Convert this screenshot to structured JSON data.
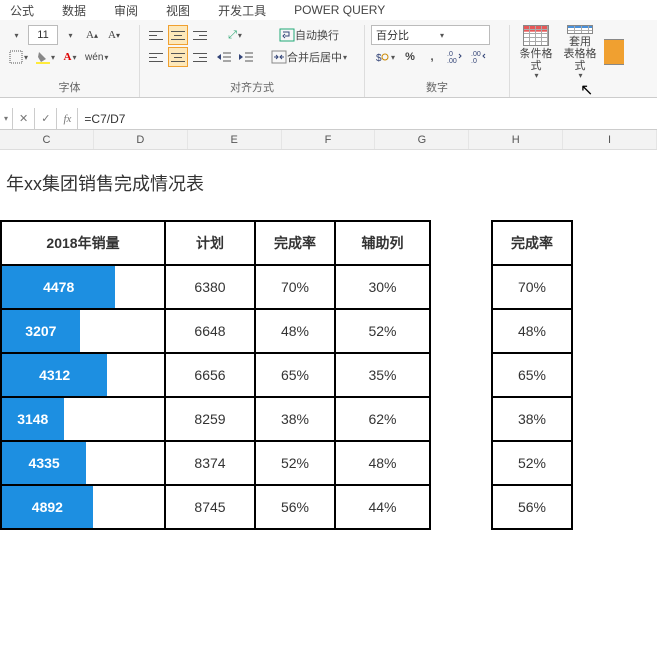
{
  "menu": {
    "items": [
      "公式",
      "数据",
      "审阅",
      "视图",
      "开发工具",
      "POWER QUERY"
    ]
  },
  "ribbon": {
    "font": {
      "size": "11",
      "group_label": "字体",
      "pinyin": "wén"
    },
    "align": {
      "wrap": "自动换行",
      "merge": "合并后居中",
      "group_label": "对齐方式"
    },
    "number": {
      "format": "百分比",
      "group_label": "数字"
    },
    "styles": {
      "cond_format": "条件格式",
      "table_format": "套用\n表格格式"
    }
  },
  "formula_bar": {
    "cancel": "✕",
    "accept": "✓",
    "fx": "fx",
    "formula": "=C7/D7"
  },
  "columns": [
    "C",
    "D",
    "E",
    "F",
    "G",
    "H",
    "I"
  ],
  "sheet": {
    "title": "年xx集团销售完成情况表",
    "chart_data": {
      "type": "table",
      "headers": {
        "sales": "2018年销量",
        "plan": "计划",
        "rate": "完成率",
        "aux": "辅助列"
      },
      "rows": [
        {
          "sales": 4478,
          "plan": 6380,
          "rate": "70%",
          "aux": "30%",
          "bar_pct": 70
        },
        {
          "sales": 3207,
          "plan": 6648,
          "rate": "48%",
          "aux": "52%",
          "bar_pct": 48
        },
        {
          "sales": 4312,
          "plan": 6656,
          "rate": "65%",
          "aux": "35%",
          "bar_pct": 65
        },
        {
          "sales": 3148,
          "plan": 8259,
          "rate": "38%",
          "aux": "62%",
          "bar_pct": 38
        },
        {
          "sales": 4335,
          "plan": 8374,
          "rate": "52%",
          "aux": "48%",
          "bar_pct": 52
        },
        {
          "sales": 4892,
          "plan": 8745,
          "rate": "56%",
          "aux": "44%",
          "bar_pct": 56
        }
      ]
    },
    "side_header": "完成率"
  }
}
